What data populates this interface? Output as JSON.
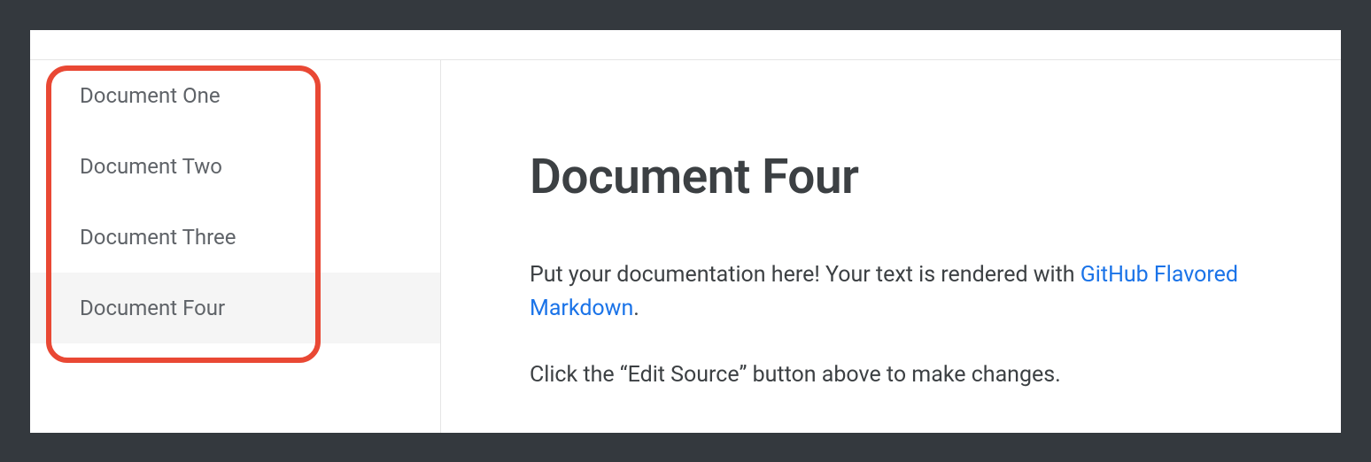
{
  "sidebar": {
    "items": [
      {
        "label": "Document One",
        "active": false
      },
      {
        "label": "Document Two",
        "active": false
      },
      {
        "label": "Document Three",
        "active": false
      },
      {
        "label": "Document Four",
        "active": true
      }
    ]
  },
  "main": {
    "title": "Document Four",
    "paragraph1_pre": "Put your documentation here! Your text is rendered with ",
    "paragraph1_link": "GitHub Flavored Markdown",
    "paragraph1_post": ".",
    "paragraph2": "Click the “Edit Source” button above to make changes."
  }
}
